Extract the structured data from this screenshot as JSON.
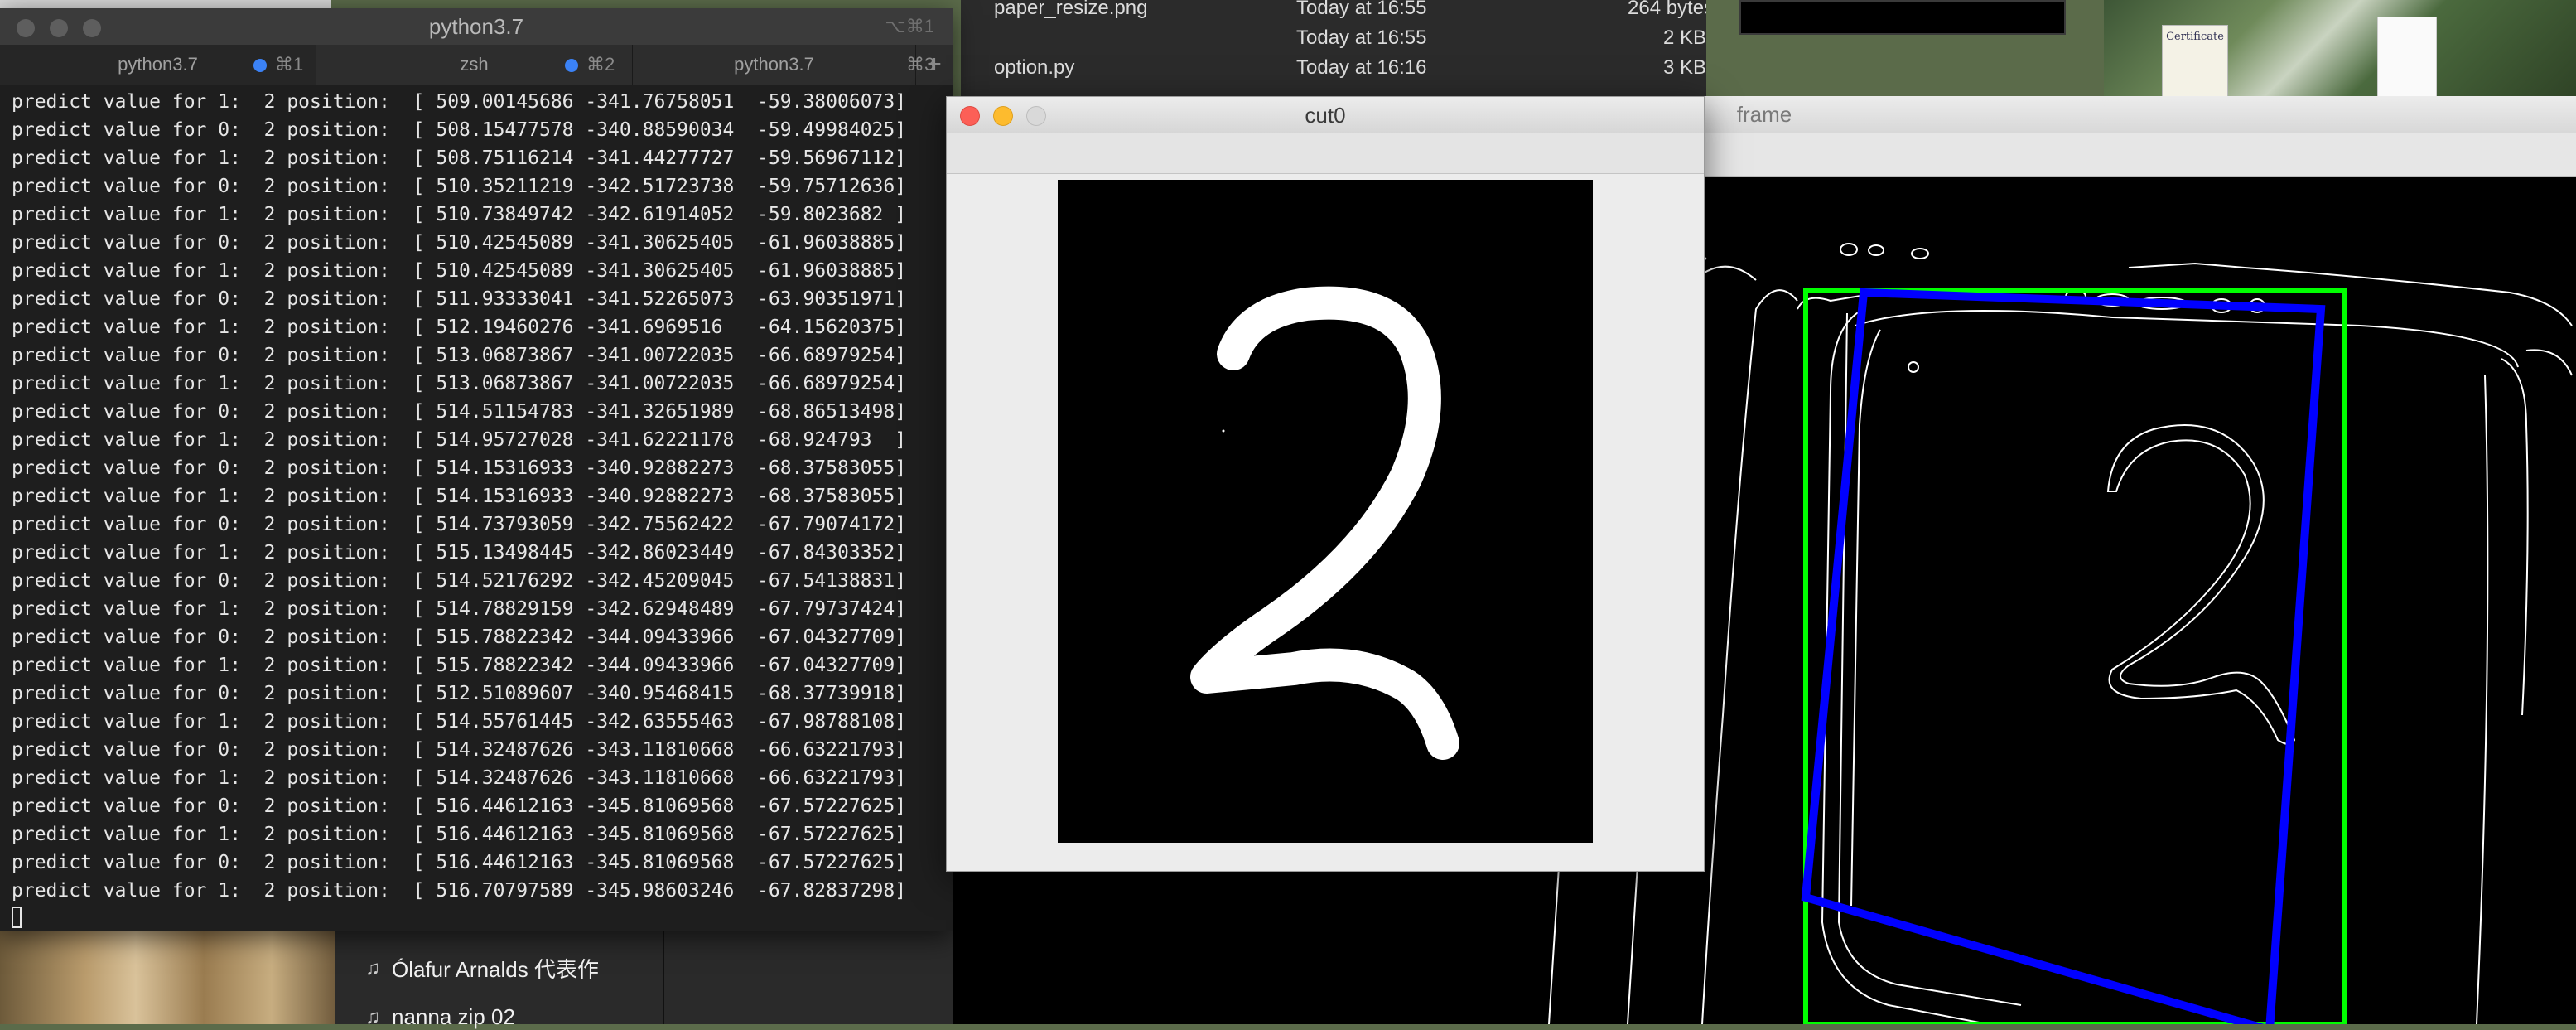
{
  "background": {
    "finder_rows": [
      {
        "name": "paper_resize.png",
        "date": "Today at 16:55",
        "size": "264 bytes"
      },
      {
        "name": "",
        "date": "Today at 16:55",
        "size": "2 KB"
      },
      {
        "name": "option.py",
        "date": "Today at 16:16",
        "size": "3 KB"
      }
    ],
    "certificate_text": "Certificate",
    "music_items": [
      "Ólafur Arnalds 代表作",
      "nanna zip 02"
    ]
  },
  "terminal": {
    "title": "python3.7",
    "title_shortcut": "⌥⌘1",
    "tabs": [
      {
        "label": "python3.7",
        "shortcut": "⌘1"
      },
      {
        "label": "zsh",
        "shortcut": "⌘2"
      },
      {
        "label": "python3.7",
        "shortcut": "⌘3"
      }
    ],
    "new_tab_label": "+",
    "lines": [
      "predict value for 1:  2 position:  [ 509.00145686 -341.76758051  -59.38006073]",
      "predict value for 0:  2 position:  [ 508.15477578 -340.88590034  -59.49984025]",
      "predict value for 1:  2 position:  [ 508.75116214 -341.44277727  -59.56967112]",
      "predict value for 0:  2 position:  [ 510.35211219 -342.51723738  -59.75712636]",
      "predict value for 1:  2 position:  [ 510.73849742 -342.61914052  -59.8023682 ]",
      "predict value for 0:  2 position:  [ 510.42545089 -341.30625405  -61.96038885]",
      "predict value for 1:  2 position:  [ 510.42545089 -341.30625405  -61.96038885]",
      "predict value for 0:  2 position:  [ 511.93333041 -341.52265073  -63.90351971]",
      "predict value for 1:  2 position:  [ 512.19460276 -341.6969516   -64.15620375]",
      "predict value for 0:  2 position:  [ 513.06873867 -341.00722035  -66.68979254]",
      "predict value for 1:  2 position:  [ 513.06873867 -341.00722035  -66.68979254]",
      "predict value for 0:  2 position:  [ 514.51154783 -341.32651989  -68.86513498]",
      "predict value for 1:  2 position:  [ 514.95727028 -341.62221178  -68.924793  ]",
      "predict value for 0:  2 position:  [ 514.15316933 -340.92882273  -68.37583055]",
      "predict value for 1:  2 position:  [ 514.15316933 -340.92882273  -68.37583055]",
      "predict value for 0:  2 position:  [ 514.73793059 -342.75562422  -67.79074172]",
      "predict value for 1:  2 position:  [ 515.13498445 -342.86023449  -67.84303352]",
      "predict value for 0:  2 position:  [ 514.52176292 -342.45209045  -67.54138831]",
      "predict value for 1:  2 position:  [ 514.78829159 -342.62948489  -67.79737424]",
      "predict value for 0:  2 position:  [ 515.78822342 -344.09433966  -67.04327709]",
      "predict value for 1:  2 position:  [ 515.78822342 -344.09433966  -67.04327709]",
      "predict value for 0:  2 position:  [ 512.51089607 -340.95468415  -68.37739918]",
      "predict value for 1:  2 position:  [ 514.55761445 -342.63555463  -67.98788108]",
      "predict value for 0:  2 position:  [ 514.32487626 -343.11810668  -66.63221793]",
      "predict value for 1:  2 position:  [ 514.32487626 -343.11810668  -66.63221793]",
      "predict value for 0:  2 position:  [ 516.44612163 -345.81069568  -67.57227625]",
      "predict value for 1:  2 position:  [ 516.44612163 -345.81069568  -67.57227625]",
      "predict value for 0:  2 position:  [ 516.44612163 -345.81069568  -67.57227625]",
      "predict value for 1:  2 position:  [ 516.70797589 -345.98603246  -67.82837298]"
    ]
  },
  "cut_window": {
    "title": "cut0",
    "digit": "2"
  },
  "frame_window": {
    "title": "frame",
    "bbox_color": "#00ff00",
    "rotated_box_color": "#0000ff"
  }
}
